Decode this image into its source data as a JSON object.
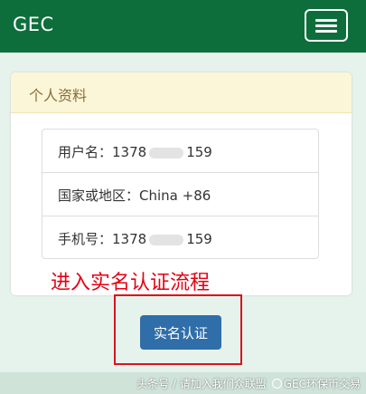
{
  "navbar": {
    "brand": "GEC",
    "menu_icon": "hamburger-icon"
  },
  "panel": {
    "title": "个人资料",
    "rows": [
      {
        "label": "用户名：",
        "value_start": "1378",
        "value_end": "159"
      },
      {
        "label": "国家或地区：",
        "value": "China +86"
      },
      {
        "label": "手机号：",
        "value_start": "1378",
        "value_end": "159"
      }
    ]
  },
  "annotation": {
    "text": "进入实名认证流程",
    "color": "#e60012"
  },
  "action": {
    "verify_label": "实名认证"
  },
  "watermark": {
    "prefix": "头条号 / 请加入我们众联盟",
    "account": "GEC环保币交易",
    "logo_icon": "toutiao-logo-icon"
  },
  "colors": {
    "navbar": "#0d6e3c",
    "page_background": "#e6f2ec",
    "panel_heading": "#fcf6d8",
    "button": "#2f6ea9",
    "highlight_border": "#d8141c"
  }
}
